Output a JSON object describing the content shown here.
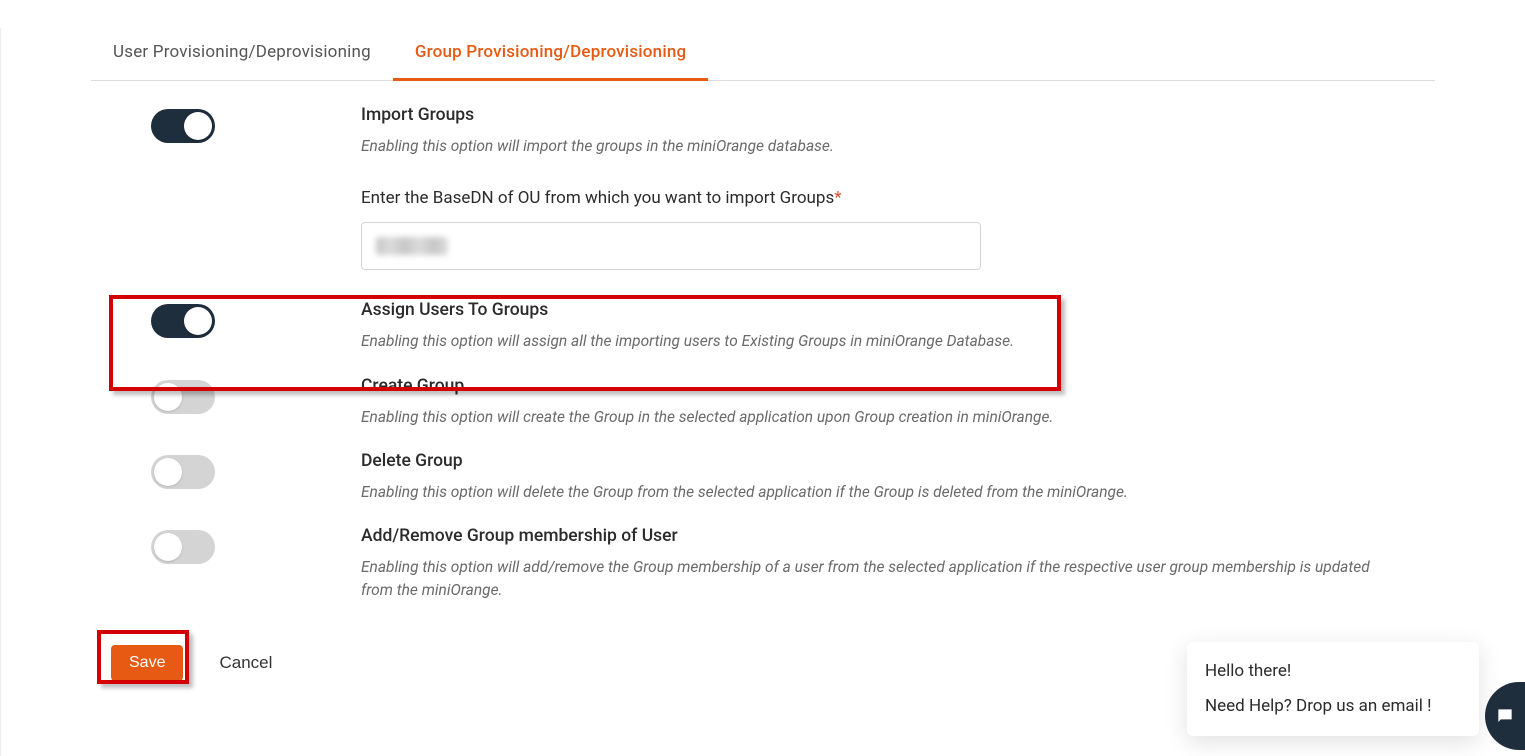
{
  "tabs": {
    "user": "User Provisioning/Deprovisioning",
    "group": "Group Provisioning/Deprovisioning"
  },
  "importGroups": {
    "title": "Import Groups",
    "desc": "Enabling this option will import the groups in the miniOrange database.",
    "basednLabel": "Enter the BaseDN of OU from which you want to import Groups",
    "toggle": true
  },
  "assignUsers": {
    "title": "Assign Users To Groups",
    "desc": "Enabling this option will assign all the importing users to Existing Groups in miniOrange Database.",
    "toggle": true
  },
  "createGroup": {
    "title": "Create Group",
    "desc": "Enabling this option will create the Group in the selected application upon Group creation in miniOrange.",
    "toggle": false
  },
  "deleteGroup": {
    "title": "Delete Group",
    "desc": "Enabling this option will delete the Group from the selected application if the Group is deleted from the miniOrange.",
    "toggle": false
  },
  "membership": {
    "title": "Add/Remove Group membership of User",
    "desc": "Enabling this option will add/remove the Group membership of a user from the selected application if the respective user group membership is updated from the miniOrange.",
    "toggle": false
  },
  "buttons": {
    "save": "Save",
    "cancel": "Cancel"
  },
  "chat": {
    "line1": "Hello there!",
    "line2": "Need Help? Drop us an email !"
  }
}
